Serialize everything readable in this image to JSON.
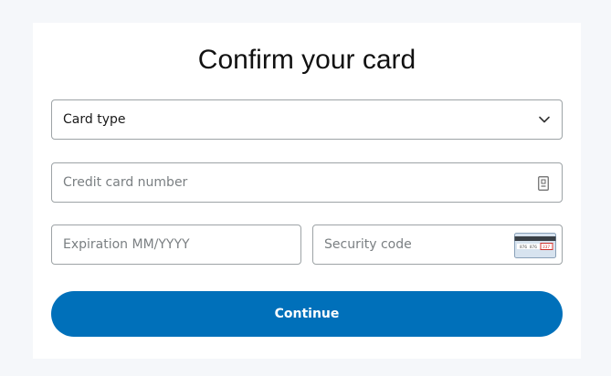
{
  "page": {
    "title": "Confirm your card"
  },
  "form": {
    "card_type": {
      "value": "Card type",
      "icon": "chevron-down-icon"
    },
    "card_number": {
      "placeholder": "Credit card number",
      "icon": "card-number-icon"
    },
    "expiration": {
      "placeholder": "Expiration MM/YYYY"
    },
    "security_code": {
      "placeholder": "Security code",
      "icon": "card-back-cvv-icon",
      "icon_sample_text": "876 876",
      "icon_cvv_text": "337"
    },
    "continue_label": "Continue"
  },
  "colors": {
    "page_background": "#f5f7fa",
    "card_background": "#ffffff",
    "field_border": "#9da3a6",
    "primary_button": "#0070ba",
    "button_text": "#ffffff",
    "placeholder_text": "#7a7f82"
  }
}
